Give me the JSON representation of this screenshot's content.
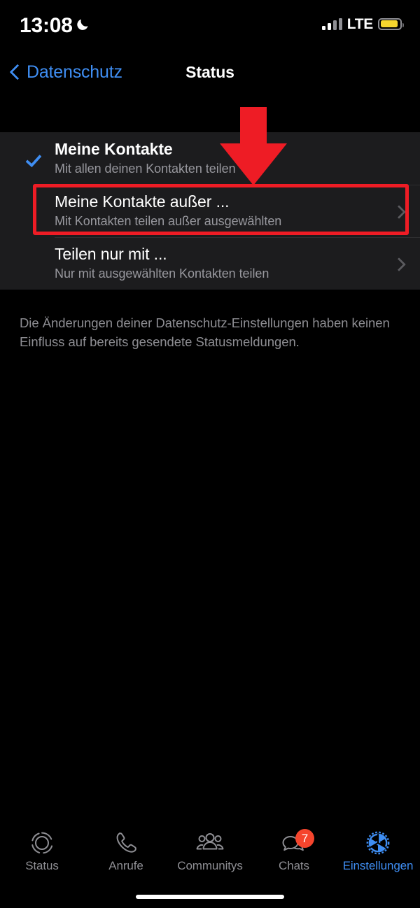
{
  "status_bar": {
    "time": "13:08",
    "moon_icon": "crescent-moon-icon",
    "network_label": "LTE",
    "signal_bars_filled": 2,
    "signal_bars_total": 4,
    "battery_color": "#f5d52e",
    "battery_level_percent": 70
  },
  "nav": {
    "back_label": "Datenschutz",
    "back_icon": "chevron-left-icon",
    "title": "Status"
  },
  "list": {
    "rows": [
      {
        "title": "Meine Kontakte",
        "subtitle": "Mit allen deinen Kontakten teilen",
        "selected": true,
        "accessory": "checkmark"
      },
      {
        "title": "Meine Kontakte außer ...",
        "subtitle": "Mit Kontakten teilen außer ausgewählten",
        "selected": false,
        "accessory": "chevron"
      },
      {
        "title": "Teilen nur mit ...",
        "subtitle": "Nur mit ausgewählten Kontakten teilen",
        "selected": false,
        "accessory": "chevron"
      }
    ]
  },
  "footer": {
    "note": "Die Änderungen deiner Datenschutz-Einstellungen haben keinen Einfluss auf bereits gesendete Statusmeldungen."
  },
  "annotation": {
    "color": "#ee1c25",
    "arrow_icon": "down-arrow-annotation",
    "highlight_target": "Meine Kontakte außer ..."
  },
  "tab_bar": {
    "active_tab": "Einstellungen",
    "active_color": "#3f8ef3",
    "inactive_color": "#8e8e93",
    "tabs": [
      {
        "label": "Status",
        "icon": "status-ring-icon",
        "badge": ""
      },
      {
        "label": "Anrufe",
        "icon": "phone-icon",
        "badge": ""
      },
      {
        "label": "Communitys",
        "icon": "communities-people-icon",
        "badge": ""
      },
      {
        "label": "Chats",
        "icon": "chat-bubbles-icon",
        "badge": "7"
      },
      {
        "label": "Einstellungen",
        "icon": "gear-icon",
        "badge": ""
      }
    ]
  },
  "home_indicator": {
    "present": true
  }
}
